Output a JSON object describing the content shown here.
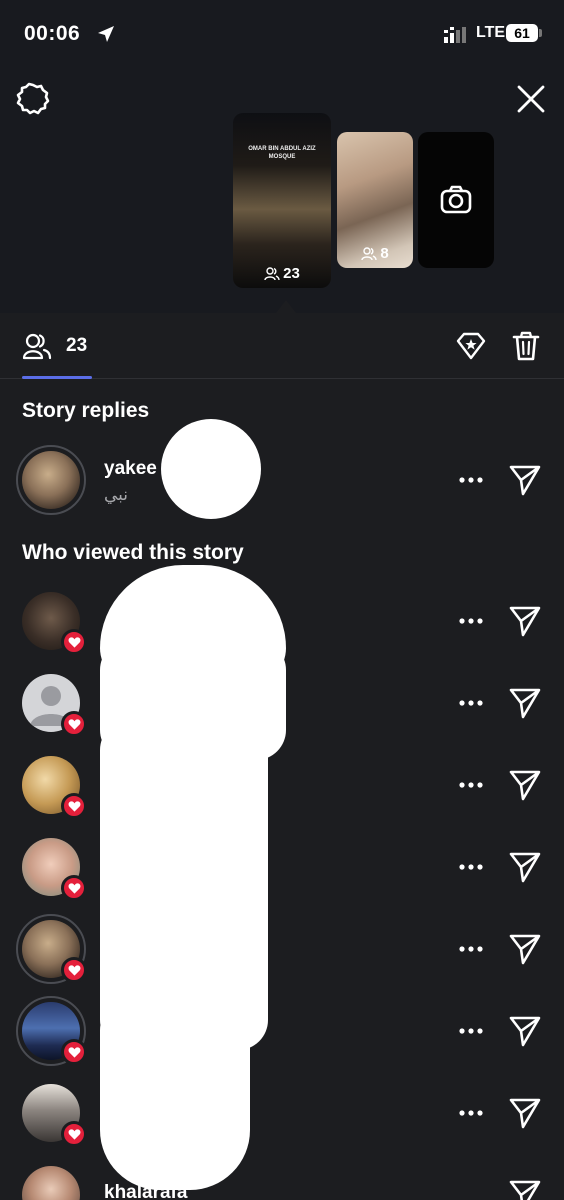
{
  "status_bar": {
    "time": "00:06",
    "network": "LTE",
    "battery": "61"
  },
  "story_thumbs": [
    {
      "caption_line1": "OMAR BIN ABDUL AZIZ",
      "caption_line2": "MOSQUE",
      "viewers": "23"
    },
    {
      "viewers": "8"
    },
    {
      "icon": "camera-icon"
    }
  ],
  "tabs": {
    "viewer_count": "23"
  },
  "sections": {
    "replies_title": "Story replies",
    "viewers_title": "Who viewed this story"
  },
  "replies": [
    {
      "username": "yakee",
      "reply": "نبي"
    }
  ],
  "viewers": [
    {
      "username": ""
    },
    {
      "username": ""
    },
    {
      "username": ""
    },
    {
      "username": ""
    },
    {
      "username": ""
    },
    {
      "username": ""
    },
    {
      "username": ""
    },
    {
      "username": "khalarafa"
    }
  ],
  "colors": {
    "background": "#1c1d20",
    "accent": "#5b6ee8",
    "heart": "#e4203b"
  }
}
